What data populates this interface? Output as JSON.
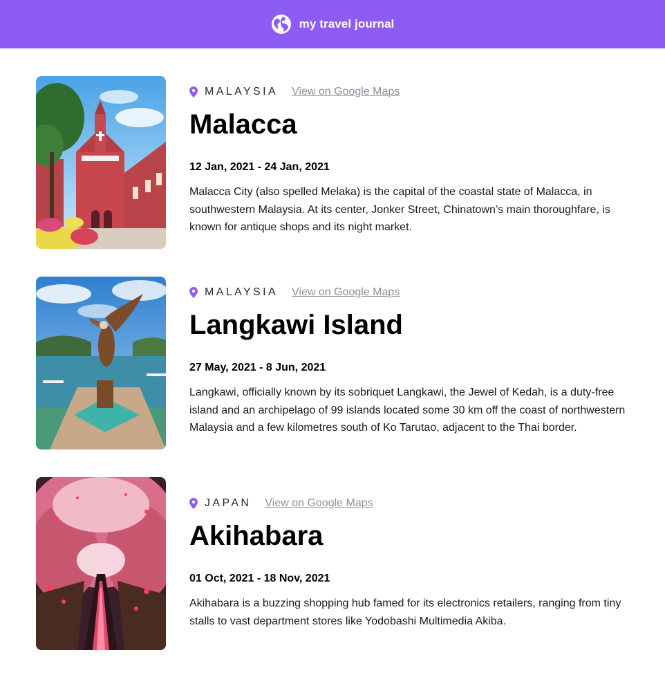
{
  "header": {
    "title": "my travel journal",
    "icon": "globe-icon"
  },
  "entries": [
    {
      "country": "MALAYSIA",
      "maps_link": "View on Google Maps",
      "place": "Malacca",
      "dates": "12 Jan, 2021 - 24 Jan, 2021",
      "description": "Malacca City (also spelled Melaka) is the capital of the coastal state of Malacca, in southwestern Malaysia. At its center, Jonker Street, Chinatown’s main thoroughfare, is known for antique shops and its night market."
    },
    {
      "country": "MALAYSIA",
      "maps_link": "View on Google Maps",
      "place": "Langkawi Island",
      "dates": "27 May, 2021 - 8 Jun, 2021",
      "description": "Langkawi, officially known by its sobriquet Langkawi, the Jewel of Kedah, is a duty-free island and an archipelago of 99 islands located some 30 km off the coast of northwestern Malaysia and a few kilometres south of Ko Tarutao, adjacent to the Thai border."
    },
    {
      "country": "JAPAN",
      "maps_link": "View on Google Maps",
      "place": "Akihabara",
      "dates": "01 Oct, 2021 - 18 Nov, 2021",
      "description": "Akihabara is a buzzing shopping hub famed for its electronics retailers, ranging from tiny stalls to vast department stores like Yodobashi Multimedia Akiba."
    }
  ],
  "colors": {
    "navbar": "#8c5cf5",
    "pin": "#8c5cf5",
    "link": "#918e9b"
  }
}
